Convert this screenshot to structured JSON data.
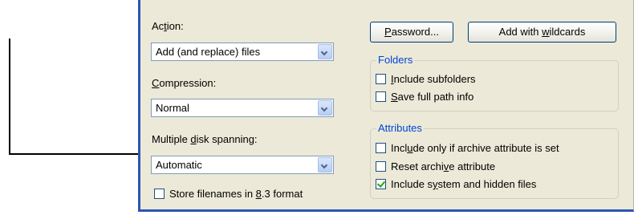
{
  "labels": {
    "action": [
      "Ac",
      "t",
      "ion:"
    ],
    "compression": [
      "",
      "C",
      "ompression:"
    ],
    "spanning": [
      "Multiple ",
      "d",
      "isk spanning:"
    ]
  },
  "combos": {
    "action": "Add (and replace) files",
    "compression": "Normal",
    "spanning": "Automatic"
  },
  "store_83": {
    "parts": [
      "Store filenames in ",
      "8",
      ".3 format"
    ],
    "checked": false
  },
  "buttons": {
    "password": [
      "",
      "P",
      "assword..."
    ],
    "wildcards": [
      "Add with ",
      "w",
      "ildcards"
    ]
  },
  "folders": {
    "title": "Folders",
    "include_subfolders": {
      "parts": [
        "",
        "I",
        "nclude subfolders"
      ],
      "checked": false
    },
    "save_full_path": {
      "parts": [
        "",
        "S",
        "ave full path info"
      ],
      "checked": false
    }
  },
  "attributes": {
    "title": "Attributes",
    "archive_only": {
      "parts": [
        "Incl",
        "u",
        "de only if archive attribute is set"
      ],
      "checked": false
    },
    "reset_archive": {
      "parts": [
        "Reset archi",
        "v",
        "e attribute"
      ],
      "checked": false
    },
    "system_hidden": {
      "parts": [
        "Include s",
        "y",
        "stem and hidden files"
      ],
      "checked": true
    }
  },
  "colors": {
    "accent": "#2e55b5",
    "group_title": "#0046d5",
    "panel": "#ece9d8"
  }
}
